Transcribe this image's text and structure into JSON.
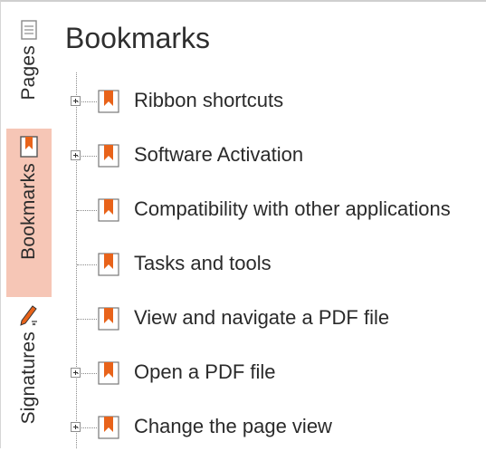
{
  "rail": {
    "tabs": [
      {
        "id": "pages",
        "label": "Pages",
        "icon": "pages-icon"
      },
      {
        "id": "bookmarks",
        "label": "Bookmarks",
        "icon": "bookmark-icon",
        "active": true
      },
      {
        "id": "signatures",
        "label": "Signatures",
        "icon": "signature-pen-icon"
      }
    ]
  },
  "panel": {
    "title": "Bookmarks",
    "items": [
      {
        "label": "Ribbon shortcuts",
        "expandable": true
      },
      {
        "label": "Software Activation",
        "expandable": true
      },
      {
        "label": "Compatibility with other applications",
        "expandable": false
      },
      {
        "label": "Tasks and tools",
        "expandable": false
      },
      {
        "label": "View and navigate a PDF file",
        "expandable": false
      },
      {
        "label": "Open a PDF file",
        "expandable": true
      },
      {
        "label": "Change the page view",
        "expandable": true
      }
    ]
  },
  "colors": {
    "accent": "#e8631a",
    "active_tab_bg": "#f6c6b6"
  }
}
